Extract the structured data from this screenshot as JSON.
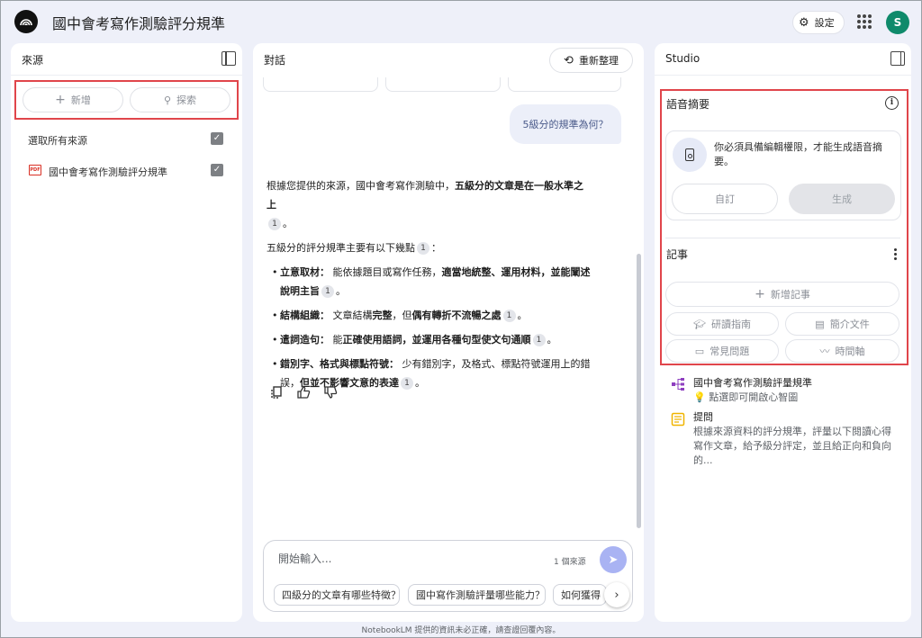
{
  "header": {
    "title": "國中會考寫作測驗評分規準",
    "settings_label": "設定",
    "avatar_initial": "S"
  },
  "sources": {
    "title": "來源",
    "add_label": "新增",
    "explore_label": "探索",
    "select_all_label": "選取所有來源",
    "items": [
      {
        "type": "PDF",
        "name": "國中會考寫作測驗評分規準",
        "checked": true
      }
    ]
  },
  "chat": {
    "title": "對話",
    "refresh_label": "重新整理",
    "user_message": "5級分的規準為何？",
    "answer": {
      "intro_pre": "根據您提供的來源，國中會考寫作測驗中，",
      "intro_bold": "五級分的文章是在一般水準之上",
      "cite": "1",
      "list_intro": "五級分的評分規準主要有以下幾點",
      "bullets": [
        {
          "label": "立意取材：",
          "text": "能依據題目或寫作任務，",
          "bold": "適當地統整、運用材料，並能闡述說明主旨"
        },
        {
          "label": "結構組織：",
          "text": "文章結構",
          "bold": "完整",
          "text2": "，但",
          "bold2": "偶有轉折不流暢之處"
        },
        {
          "label": "遣詞造句：",
          "text": "能",
          "bold": "正確使用語詞，並運用各種句型使文句通順"
        },
        {
          "label": "錯別字、格式與標點符號：",
          "text": "少有錯別字，及格式、標點符號運用上的錯誤，",
          "bold": "但並不影響文意的表達"
        }
      ]
    },
    "composer": {
      "placeholder": "開始輸入...",
      "source_count": "1 個來源"
    },
    "suggestions": [
      "四級分的文章有哪些特徵？",
      "國中寫作測驗評量哪些能力？",
      "如何獲得"
    ],
    "footer": "NotebookLM 提供的資訊未必正確，請查證回覆內容。"
  },
  "studio": {
    "title": "Studio",
    "audio": {
      "title": "語音摘要",
      "message": "你必須具備編輯權限，才能生成語音摘要。",
      "customize_label": "自訂",
      "generate_label": "生成"
    },
    "notes": {
      "title": "記事",
      "add_label": "新增記事",
      "study_guide": "研讀指南",
      "briefing": "簡介文件",
      "faq": "常見問題",
      "timeline": "時間軸",
      "items": [
        {
          "title": "國中會考寫作測驗評量規準",
          "sub": "💡 點選即可開啟心智圖",
          "icon": "mindmap-icon"
        },
        {
          "title": "提問",
          "sub": "根據來源資料的評分規準，評量以下閱讀心得寫作文章，給予級分評定，並且給正向和負向的...",
          "icon": "note-icon"
        }
      ]
    }
  },
  "colors": {
    "accent": "#a9b3f3",
    "highlight": "#e0454b",
    "avatar": "#0f8a6b"
  }
}
